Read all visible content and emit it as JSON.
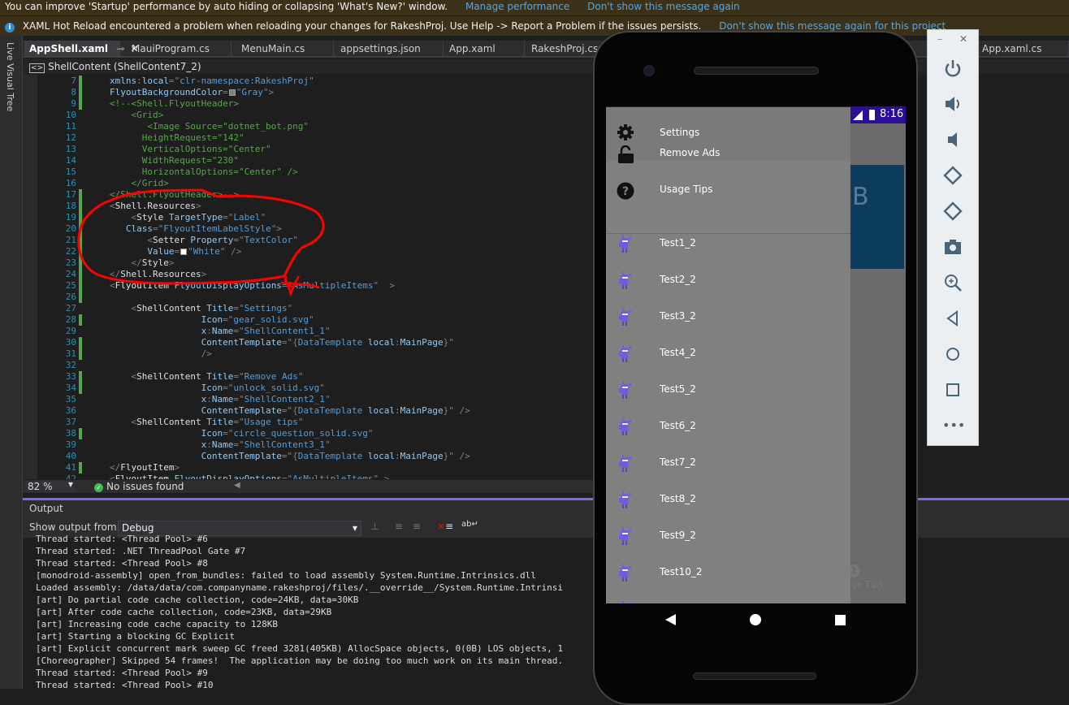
{
  "notifications": {
    "perf_message": "You can improve 'Startup' performance by auto hiding or collapsing 'What's New?' window.",
    "manage_performance": "Manage performance",
    "dont_show_perf": "Don't show this message again",
    "hot_reload_message": "XAML Hot Reload encountered a problem when reloading your changes for RakeshProj. Use Help -> Report a Problem if the issues persists.",
    "dont_show_project": "Don't show this message again for this project"
  },
  "live_visual_tree": "Live Visual Tree",
  "tabs": [
    {
      "label": "AppShell.xaml",
      "active": true
    },
    {
      "label": "MauiProgram.cs"
    },
    {
      "label": "MenuMain.cs"
    },
    {
      "label": "appsettings.json"
    },
    {
      "label": "App.xaml"
    },
    {
      "label": "RakeshProj.csproj"
    },
    {
      "label": "App.xaml.cs"
    }
  ],
  "breadcrumb": "ShellContent (ShellContent7_2)",
  "code_lines": [
    {
      "n": "7",
      "mod": true,
      "segs": [
        [
          "xmlns",
          "a"
        ],
        [
          ":",
          "p"
        ],
        [
          "local",
          "a"
        ],
        [
          "=\"",
          "p"
        ],
        [
          "clr-namespace:RakeshProj",
          "v"
        ],
        [
          "\"",
          "p"
        ]
      ]
    },
    {
      "n": "8",
      "mod": true,
      "segs": [
        [
          "FlyoutBackgroundColor",
          "a"
        ],
        [
          "=",
          "p"
        ],
        [
          "#808080",
          "sw"
        ],
        [
          "\"",
          "p"
        ],
        [
          "Gray",
          "v"
        ],
        [
          "\">",
          "p"
        ]
      ]
    },
    {
      "n": "9",
      "mod": true,
      "segs": [
        [
          "<!--<Shell.FlyoutHeader>",
          "c"
        ]
      ]
    },
    {
      "n": "10",
      "segs": [
        [
          "    <Grid>",
          "c"
        ]
      ]
    },
    {
      "n": "11",
      "segs": [
        [
          "       <Image Source=\"dotnet_bot.png\"",
          "c"
        ]
      ]
    },
    {
      "n": "12",
      "segs": [
        [
          "      HeightRequest=\"142\"",
          "c"
        ]
      ]
    },
    {
      "n": "13",
      "segs": [
        [
          "      VerticalOptions=\"Center\"",
          "c"
        ]
      ]
    },
    {
      "n": "14",
      "segs": [
        [
          "      WidthRequest=\"230\"",
          "c"
        ]
      ]
    },
    {
      "n": "15",
      "segs": [
        [
          "      HorizontalOptions=\"Center\" />",
          "c"
        ]
      ]
    },
    {
      "n": "16",
      "segs": [
        [
          "    </Grid>",
          "c"
        ]
      ]
    },
    {
      "n": "17",
      "mod": true,
      "segs": [
        [
          "</Shell.FlyoutHeader>-->",
          "c"
        ]
      ]
    },
    {
      "n": "18",
      "mod": true,
      "segs": [
        [
          "<",
          "p"
        ],
        [
          "Shell.Resources",
          "e"
        ],
        [
          ">",
          "p"
        ]
      ]
    },
    {
      "n": "19",
      "mod": true,
      "segs": [
        [
          "    <",
          "p"
        ],
        [
          "Style",
          "e"
        ],
        [
          " TargetType",
          "a"
        ],
        [
          "=\"",
          "p"
        ],
        [
          "Label",
          "v"
        ],
        [
          "\"",
          "p"
        ]
      ]
    },
    {
      "n": "20",
      "mod": true,
      "segs": [
        [
          "   Class",
          "a"
        ],
        [
          "=\"",
          "p"
        ],
        [
          "FlyoutItemLabelStyle",
          "v"
        ],
        [
          "\">",
          "p"
        ]
      ]
    },
    {
      "n": "21",
      "mod": true,
      "segs": [
        [
          "       <",
          "p"
        ],
        [
          "Setter",
          "e"
        ],
        [
          " Property",
          "a"
        ],
        [
          "=\"",
          "p"
        ],
        [
          "TextColor",
          "v"
        ],
        [
          "\"",
          "p"
        ]
      ]
    },
    {
      "n": "22",
      "mod": true,
      "segs": [
        [
          "       Value",
          "a"
        ],
        [
          "=",
          "p"
        ],
        [
          "#ffffff",
          "sw"
        ],
        [
          "\"",
          "p"
        ],
        [
          "White",
          "v"
        ],
        [
          "\" />",
          "p"
        ]
      ]
    },
    {
      "n": "23",
      "mod": true,
      "segs": [
        [
          "    </",
          "p"
        ],
        [
          "Style",
          "e"
        ],
        [
          ">",
          "p"
        ]
      ]
    },
    {
      "n": "24",
      "mod": true,
      "segs": [
        [
          "</",
          "p"
        ],
        [
          "Shell.Resources",
          "e"
        ],
        [
          ">",
          "p"
        ]
      ]
    },
    {
      "n": "25",
      "mod": true,
      "segs": [
        [
          "<",
          "p"
        ],
        [
          "FlyoutItem",
          "e"
        ],
        [
          " FlyoutDisplayOptions",
          "a"
        ],
        [
          "=\"",
          "p"
        ],
        [
          "AsMultipleItems",
          "v"
        ],
        [
          "\"  >",
          "p"
        ]
      ]
    },
    {
      "n": "26",
      "mod": true,
      "segs": []
    },
    {
      "n": "27",
      "segs": [
        [
          "    <",
          "p"
        ],
        [
          "ShellContent",
          "e"
        ],
        [
          " Title",
          "a"
        ],
        [
          "=\"",
          "p"
        ],
        [
          "Settings",
          "v"
        ],
        [
          "\"",
          "p"
        ]
      ]
    },
    {
      "n": "28",
      "mod": true,
      "segs": [
        [
          "                 Icon",
          "a"
        ],
        [
          "=\"",
          "p"
        ],
        [
          "gear_solid.svg",
          "v"
        ],
        [
          "\"",
          "p"
        ]
      ]
    },
    {
      "n": "29",
      "segs": [
        [
          "                 x",
          "a"
        ],
        [
          ":",
          "p"
        ],
        [
          "Name",
          "a"
        ],
        [
          "=\"",
          "p"
        ],
        [
          "ShellContent1_1",
          "v"
        ],
        [
          "\"",
          "p"
        ]
      ]
    },
    {
      "n": "30",
      "mod": true,
      "segs": [
        [
          "                 ContentTemplate",
          "a"
        ],
        [
          "=\"",
          "p"
        ],
        [
          "{",
          "p"
        ],
        [
          "DataTemplate",
          "v"
        ],
        [
          " local",
          "a"
        ],
        [
          ":",
          "p"
        ],
        [
          "MainPage",
          "a"
        ],
        [
          "}\"",
          "p"
        ]
      ]
    },
    {
      "n": "31",
      "mod": true,
      "segs": [
        [
          "                 />",
          "p"
        ]
      ]
    },
    {
      "n": "32",
      "segs": []
    },
    {
      "n": "33",
      "mod": true,
      "segs": [
        [
          "    <",
          "p"
        ],
        [
          "ShellContent",
          "e"
        ],
        [
          " Title",
          "a"
        ],
        [
          "=\"",
          "p"
        ],
        [
          "Remove Ads",
          "v"
        ],
        [
          "\"",
          "p"
        ]
      ]
    },
    {
      "n": "34",
      "mod": true,
      "segs": [
        [
          "                 Icon",
          "a"
        ],
        [
          "=\"",
          "p"
        ],
        [
          "unlock_solid.svg",
          "v"
        ],
        [
          "\"",
          "p"
        ]
      ]
    },
    {
      "n": "35",
      "segs": [
        [
          "                 x",
          "a"
        ],
        [
          ":",
          "p"
        ],
        [
          "Name",
          "a"
        ],
        [
          "=\"",
          "p"
        ],
        [
          "ShellContent2_1",
          "v"
        ],
        [
          "\"",
          "p"
        ]
      ]
    },
    {
      "n": "36",
      "segs": [
        [
          "                 ContentTemplate",
          "a"
        ],
        [
          "=\"",
          "p"
        ],
        [
          "{",
          "p"
        ],
        [
          "DataTemplate",
          "v"
        ],
        [
          " local",
          "a"
        ],
        [
          ":",
          "p"
        ],
        [
          "MainPage",
          "a"
        ],
        [
          "}\" />",
          "p"
        ]
      ]
    },
    {
      "n": "37",
      "segs": [
        [
          "    <",
          "p"
        ],
        [
          "ShellContent",
          "e"
        ],
        [
          " Title",
          "a"
        ],
        [
          "=\"",
          "p"
        ],
        [
          "Usage tips",
          "v"
        ],
        [
          "\"",
          "p"
        ]
      ]
    },
    {
      "n": "38",
      "mod": true,
      "segs": [
        [
          "                 Icon",
          "a"
        ],
        [
          "=\"",
          "p"
        ],
        [
          "circle_question_solid.svg",
          "v"
        ],
        [
          "\"",
          "p"
        ]
      ]
    },
    {
      "n": "39",
      "segs": [
        [
          "                 x",
          "a"
        ],
        [
          ":",
          "p"
        ],
        [
          "Name",
          "a"
        ],
        [
          "=\"",
          "p"
        ],
        [
          "ShellContent3_1",
          "v"
        ],
        [
          "\"",
          "p"
        ]
      ]
    },
    {
      "n": "40",
      "segs": [
        [
          "                 ContentTemplate",
          "a"
        ],
        [
          "=\"",
          "p"
        ],
        [
          "{",
          "p"
        ],
        [
          "DataTemplate",
          "v"
        ],
        [
          " local",
          "a"
        ],
        [
          ":",
          "p"
        ],
        [
          "MainPage",
          "a"
        ],
        [
          "}\" />",
          "p"
        ]
      ]
    },
    {
      "n": "41",
      "mod": true,
      "segs": [
        [
          "</",
          "p"
        ],
        [
          "FlyoutItem",
          "e"
        ],
        [
          ">",
          "p"
        ]
      ]
    },
    {
      "n": "42",
      "segs": [
        [
          "<",
          "p"
        ],
        [
          "FlyoutItem",
          "e"
        ],
        [
          " FlyoutDisplayOptions",
          "a"
        ],
        [
          "=\"",
          "p"
        ],
        [
          "AsMultipleItems",
          "v"
        ],
        [
          "\" >",
          "p"
        ]
      ]
    }
  ],
  "status": {
    "zoom": "82 %",
    "issues": "No issues found"
  },
  "output": {
    "title": "Output",
    "show_from_label": "Show output from:",
    "source": "Debug",
    "lines": [
      "Thread started: <Thread Pool> #6",
      "Thread started: .NET ThreadPool Gate #7",
      "Thread started: <Thread Pool> #8",
      "[monodroid-assembly] open_from_bundles: failed to load assembly System.Runtime.Intrinsics.dll",
      "Loaded assembly: /data/data/com.companyname.rakeshproj/files/.__override__/System.Runtime.Intrinsi",
      "[art] Do partial code cache collection, code=24KB, data=30KB",
      "[art] After code cache collection, code=23KB, data=29KB",
      "[art] Increasing code cache capacity to 128KB",
      "[art] Starting a blocking GC Explicit",
      "[art] Explicit concurrent mark sweep GC freed 3281(405KB) AllocSpace objects, 0(0B) LOS objects, 1",
      "[Choreographer] Skipped 54 frames!  The application may be doing too much work on its main thread.",
      "Thread started: <Thread Pool> #9",
      "Thread started: <Thread Pool> #10"
    ]
  },
  "phone": {
    "time": "8:16",
    "status_bar_color": "#2a0e9b",
    "flyout_color": "#808080",
    "background_fragments": {
      "letter": "B",
      "tips": "ge Tips"
    },
    "menu_items": [
      {
        "label": "Settings",
        "icon": "gear-icon"
      },
      {
        "label": "Remove Ads",
        "icon": "unlock-icon"
      },
      {
        "label": "Usage Tips",
        "icon": "circle-question-icon"
      }
    ],
    "test_items": [
      "Test1_2",
      "Test2_2",
      "Test3_2",
      "Test4_2",
      "Test5_2",
      "Test6_2",
      "Test7_2",
      "Test8_2",
      "Test9_2",
      "Test10_2"
    ]
  },
  "emulator_tools": [
    "power",
    "volume-up",
    "volume-down",
    "rotate-left",
    "rotate-right",
    "screenshot",
    "zoom",
    "back",
    "home",
    "overview",
    "more"
  ]
}
